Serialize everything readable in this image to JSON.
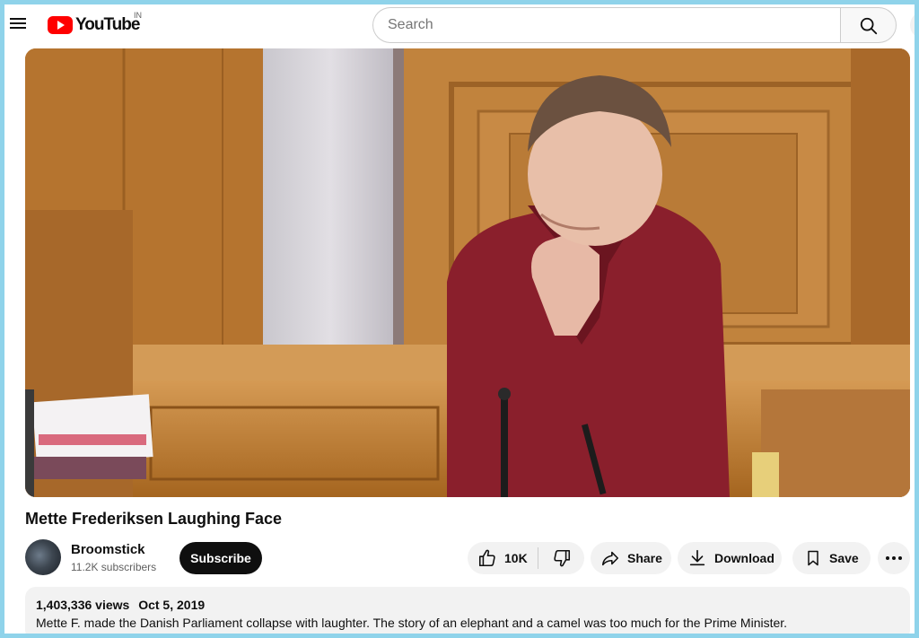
{
  "header": {
    "logo_text": "YouTube",
    "country_code": "IN",
    "search_placeholder": "Search"
  },
  "video": {
    "title": "Mette Frederiksen Laughing Face"
  },
  "channel": {
    "name": "Broomstick",
    "subscribers": "11.2K subscribers",
    "subscribe_label": "Subscribe"
  },
  "actions": {
    "like_count": "10K",
    "share_label": "Share",
    "download_label": "Download",
    "save_label": "Save"
  },
  "description": {
    "views": "1,403,336 views",
    "date": "Oct 5, 2019",
    "text": "Mette F. made the Danish Parliament collapse with laughter. The story of an elephant and a camel was too much for the Prime Minister."
  },
  "icons": {
    "menu": "hamburger-menu-icon",
    "search": "search-icon",
    "like": "thumbs-up-icon",
    "dislike": "thumbs-down-icon",
    "share": "share-arrow-icon",
    "download": "download-icon",
    "save": "bookmark-icon",
    "more": "more-horizontal-icon"
  },
  "colors": {
    "brand_red": "#ff0000",
    "border_accent": "#8fd3ea",
    "subscribe_bg": "#0f0f0f",
    "pill_bg": "#f2f2f2"
  }
}
